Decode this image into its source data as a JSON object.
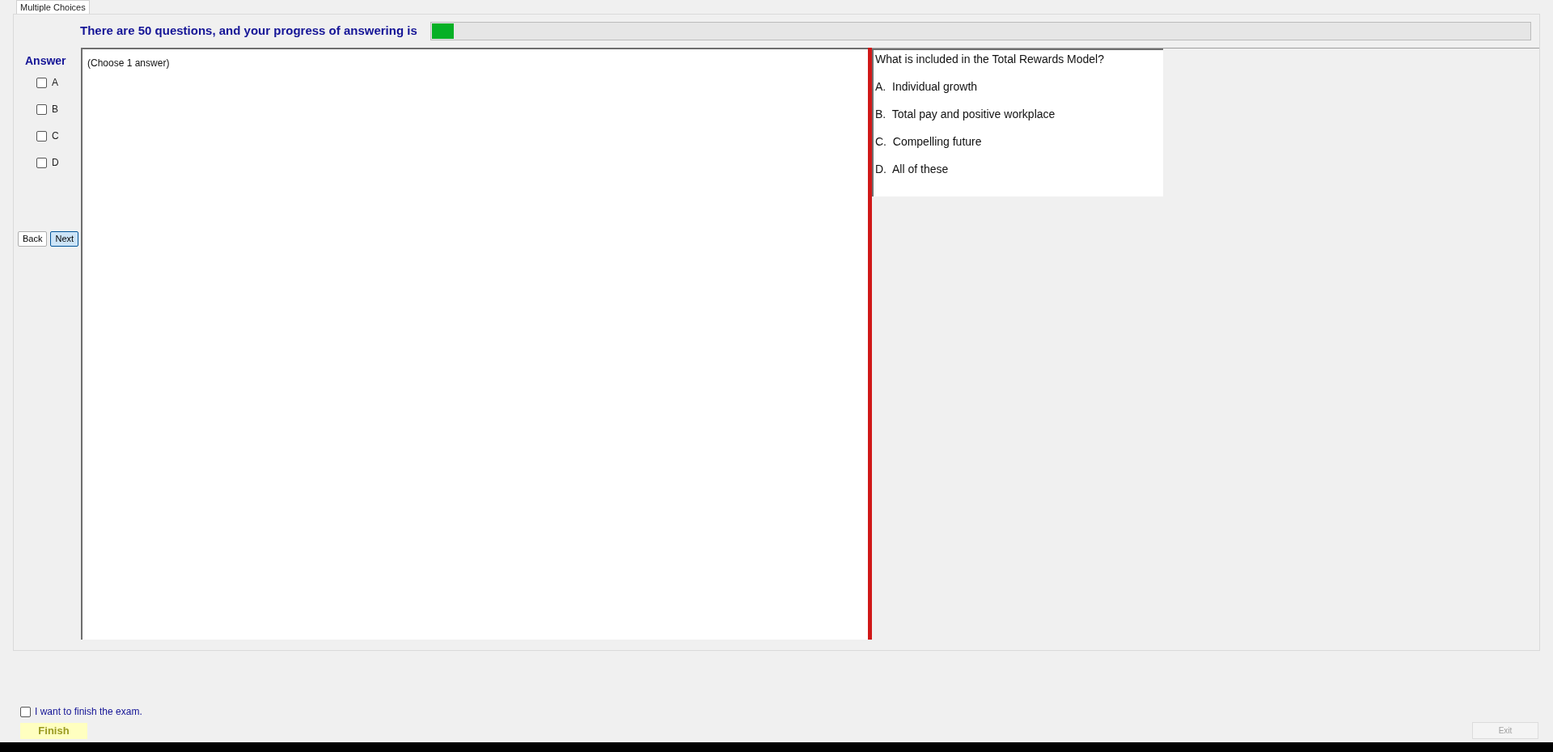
{
  "tab": {
    "label": "Multiple Choices",
    "selected": true
  },
  "progress": {
    "text": "There are 50 questions, and your progress of answering is",
    "level": 0.02
  },
  "answer": {
    "title": "Answer",
    "options": [
      {
        "label": "A",
        "checked": false
      },
      {
        "label": "B",
        "checked": false
      },
      {
        "label": "C",
        "checked": false
      },
      {
        "label": "D",
        "checked": false
      }
    ]
  },
  "nav_buttons": [
    {
      "label": "Back",
      "selected": false
    },
    {
      "label": "Next",
      "selected": true
    }
  ],
  "instruction": "(Choose 1 answer)",
  "question": {
    "text": "What is included in the Total Rewards Model?",
    "choices": [
      "A.  Individual growth",
      "B.  Total pay and positive workplace",
      "C.  Compelling future",
      "D.  All of these"
    ]
  },
  "finish_confirm": {
    "label": "I want to finish the exam.",
    "checked": false
  },
  "finish_button": "Finish",
  "exit_button": {
    "label": "Exit",
    "disabled": true
  }
}
